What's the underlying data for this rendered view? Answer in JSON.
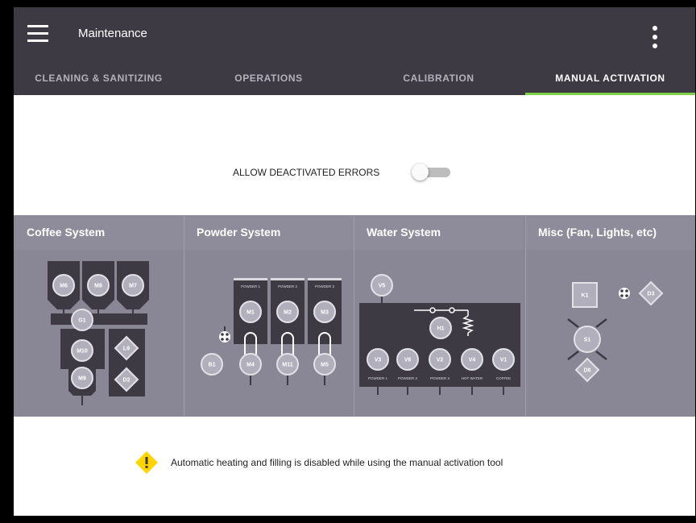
{
  "app": {
    "title": "Maintenance"
  },
  "tabs": [
    {
      "label": "CLEANING & SANITIZING"
    },
    {
      "label": "OPERATIONS"
    },
    {
      "label": "CALIBRATION"
    },
    {
      "label": "MANUAL ACTIVATION",
      "active": true
    }
  ],
  "toggle": {
    "label": "ALLOW DEACTIVATED ERRORS",
    "on": false
  },
  "systems": [
    {
      "title": "Coffee System",
      "components": [
        "M6",
        "M8",
        "M7",
        "G1",
        "M10",
        "L9",
        "M9",
        "D2"
      ]
    },
    {
      "title": "Powder System",
      "components": [
        "M1",
        "M2",
        "M3",
        "B1",
        "M4",
        "M11",
        "M5"
      ],
      "hoppers": [
        "POWDER 1",
        "POWDER 2",
        "POWDER 3"
      ]
    },
    {
      "title": "Water System",
      "components": [
        "V5",
        "H1",
        "V3",
        "V6",
        "V2",
        "V4",
        "V1"
      ],
      "outputs": [
        "POWDER 1",
        "POWDER 2",
        "POWDER 3",
        "HOT WATER",
        "COFFEE"
      ]
    },
    {
      "title": "Misc (Fan, Lights, etc)",
      "components": [
        "K1",
        "D3",
        "S1",
        "D6"
      ]
    }
  ],
  "warning": {
    "text": "Automatic heating and filling is disabled while using the manual activation tool",
    "icon": "warning-icon"
  },
  "colors": {
    "appbar": "#3d3a44",
    "accent": "#7fcf4a",
    "panel": "#898795",
    "panel_header": "#8e8c9a",
    "component": "#b1afbb",
    "warning": "#ffd400"
  }
}
